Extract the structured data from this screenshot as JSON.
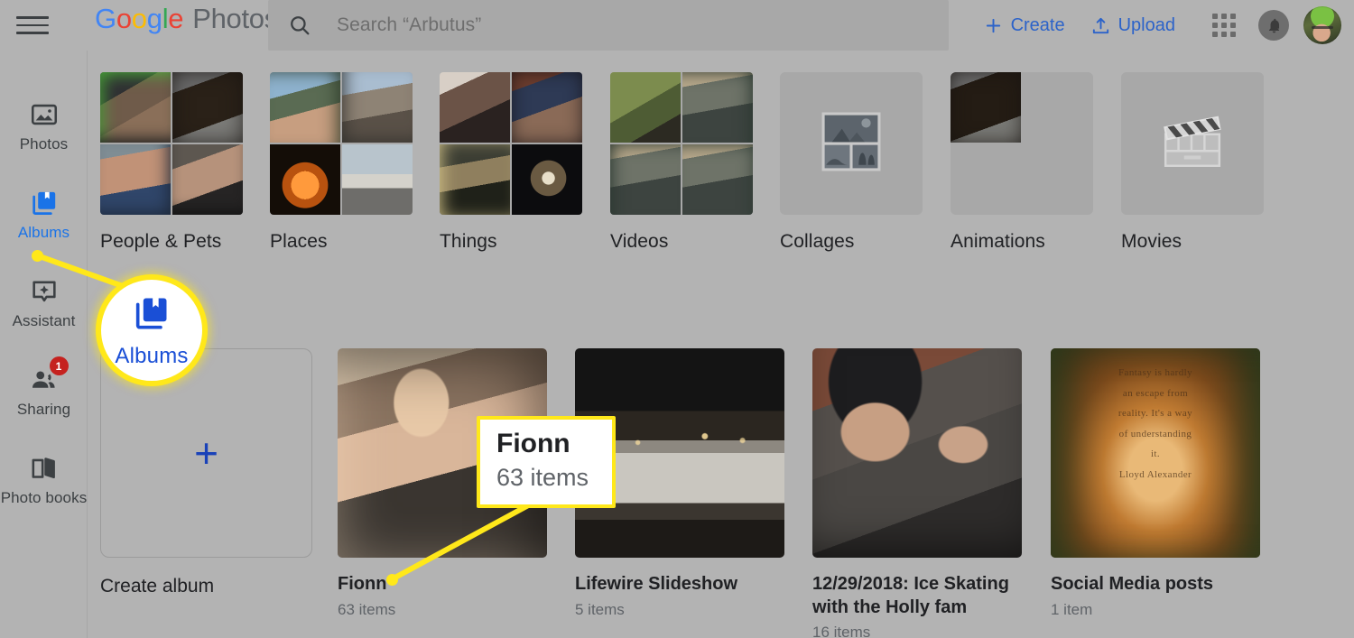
{
  "app": {
    "brand_google": "Google",
    "brand_word": "Photos",
    "title": "Google Photos"
  },
  "header": {
    "menu_icon": "hamburger-menu-icon",
    "search": {
      "icon": "search-icon",
      "placeholder": "Search “Arbutus”",
      "value": ""
    },
    "create_label": "Create",
    "create_icon": "plus-icon",
    "upload_label": "Upload",
    "upload_icon": "upload-icon",
    "apps_icon": "apps-grid-icon",
    "notifications_icon": "bell-icon",
    "avatar_icon": "user-avatar"
  },
  "sidebar": {
    "items": [
      {
        "label": "Photos",
        "icon": "photo-icon",
        "selected": false,
        "badge": null
      },
      {
        "label": "Albums",
        "icon": "albums-icon",
        "selected": true,
        "badge": null
      },
      {
        "label": "Assistant",
        "icon": "assistant-icon",
        "selected": false,
        "badge": null
      },
      {
        "label": "Sharing",
        "icon": "sharing-icon",
        "selected": false,
        "badge": "1"
      },
      {
        "label": "Photo books",
        "icon": "book-icon",
        "selected": false,
        "badge": null
      }
    ]
  },
  "categories": [
    {
      "label": "People & Pets",
      "kind": "photos"
    },
    {
      "label": "Places",
      "kind": "photos"
    },
    {
      "label": "Things",
      "kind": "photos"
    },
    {
      "label": "Videos",
      "kind": "photos"
    },
    {
      "label": "Collages",
      "kind": "placeholder",
      "placeholder_icon": "collage-placeholder-icon"
    },
    {
      "label": "Animations",
      "kind": "partial"
    },
    {
      "label": "Movies",
      "kind": "placeholder",
      "placeholder_icon": "clapperboard-icon"
    }
  ],
  "albums": {
    "create": {
      "label": "Create album",
      "icon": "plus-icon"
    },
    "items": [
      {
        "title": "Fionn",
        "count": "63 items"
      },
      {
        "title": "Lifewire Slideshow",
        "count": "5 items"
      },
      {
        "title": "12/29/2018: Ice Skating with the Holly fam",
        "count": "16 items"
      },
      {
        "title": "Social Media posts",
        "count": "1 item"
      }
    ]
  },
  "annotations": {
    "highlight_circle": {
      "label": "Albums",
      "icon": "albums-icon",
      "ring_color": "#FFE81A"
    },
    "callout_box": {
      "title": "Fionn",
      "subtitle": "63 items",
      "border_color": "#FFE81A"
    }
  },
  "thumbnail_text": {
    "social_media_quote": "Fantasy is hardly an escape from reality. It's a way of understanding it. Lloyd Alexander"
  },
  "colors": {
    "page_background": "#b3b3b3",
    "search_background": "#a8a8a8",
    "accent_blue": "#1a73e8",
    "annotation_yellow": "#FFE81A",
    "badge_red": "#c5221f"
  }
}
